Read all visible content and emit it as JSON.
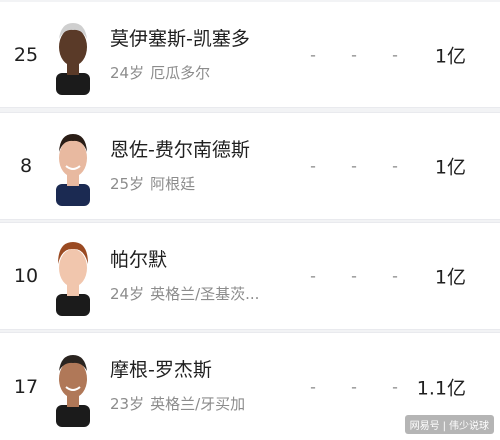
{
  "players": [
    {
      "number": "25",
      "name": "莫伊塞斯-凯塞多",
      "age": "24岁",
      "team": "厄瓜多尔",
      "stats": [
        "-",
        "-",
        "-"
      ],
      "value": "1亿",
      "skin": "#5a3a28",
      "hair": "#cfcfcf"
    },
    {
      "number": "8",
      "name": "恩佐-费尔南德斯",
      "age": "25岁",
      "team": "阿根廷",
      "stats": [
        "-",
        "-",
        "-"
      ],
      "value": "1亿",
      "skin": "#e8b9a0",
      "hair": "#2a1d16"
    },
    {
      "number": "10",
      "name": "帕尔默",
      "age": "24岁",
      "team": "英格兰/圣基茨...",
      "stats": [
        "-",
        "-",
        "-"
      ],
      "value": "1亿",
      "skin": "#f1c6ad",
      "hair": "#9a4a22"
    },
    {
      "number": "17",
      "name": "摩根-罗杰斯",
      "age": "23岁",
      "team": "英格兰/牙买加",
      "stats": [
        "-",
        "-",
        "-"
      ],
      "value": "1.1亿",
      "skin": "#b07858",
      "hair": "#2a2420"
    }
  ],
  "watermark": {
    "left": "网易号",
    "sep": "|",
    "right": "伟少说球"
  }
}
